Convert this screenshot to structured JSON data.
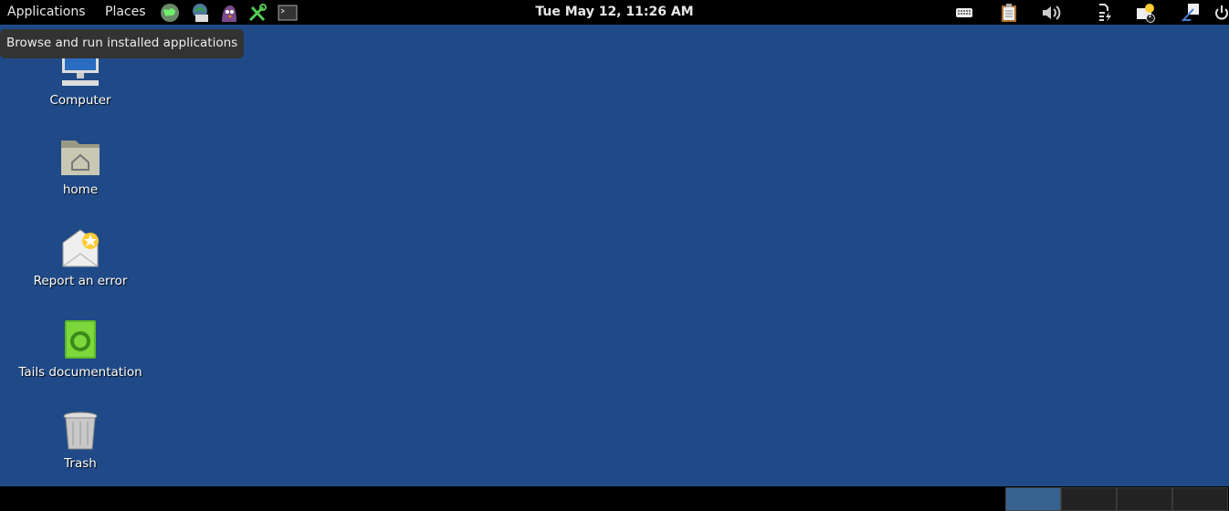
{
  "topbar": {
    "applications_label": "Applications",
    "places_label": "Places",
    "launchers": [
      "tor-browser-icon",
      "email-client-icon",
      "pidgin-icon",
      "keepassx-icon",
      "terminal-icon"
    ],
    "clock": "Tue May 12, 11:26 AM",
    "tray": [
      "keyboard-icon",
      "clipboard-icon",
      "volume-icon",
      "power-battery-icon",
      "notifications-icon",
      "network-icon",
      "power-off-icon"
    ],
    "notification_count": "1"
  },
  "tooltip": "Browse and run installed applications",
  "desktop": {
    "items": [
      {
        "label": "Computer",
        "icon": "computer-icon"
      },
      {
        "label": "home",
        "icon": "home-folder-icon"
      },
      {
        "label": "Report an error",
        "icon": "report-error-icon"
      },
      {
        "label": "Tails documentation",
        "icon": "documentation-icon"
      },
      {
        "label": "Trash",
        "icon": "trash-icon"
      }
    ]
  },
  "workspaces": {
    "count": 4,
    "active": 1
  },
  "colors": {
    "desktop": "#1f4a87",
    "panel": "#000000",
    "active_workspace": "#376390"
  }
}
